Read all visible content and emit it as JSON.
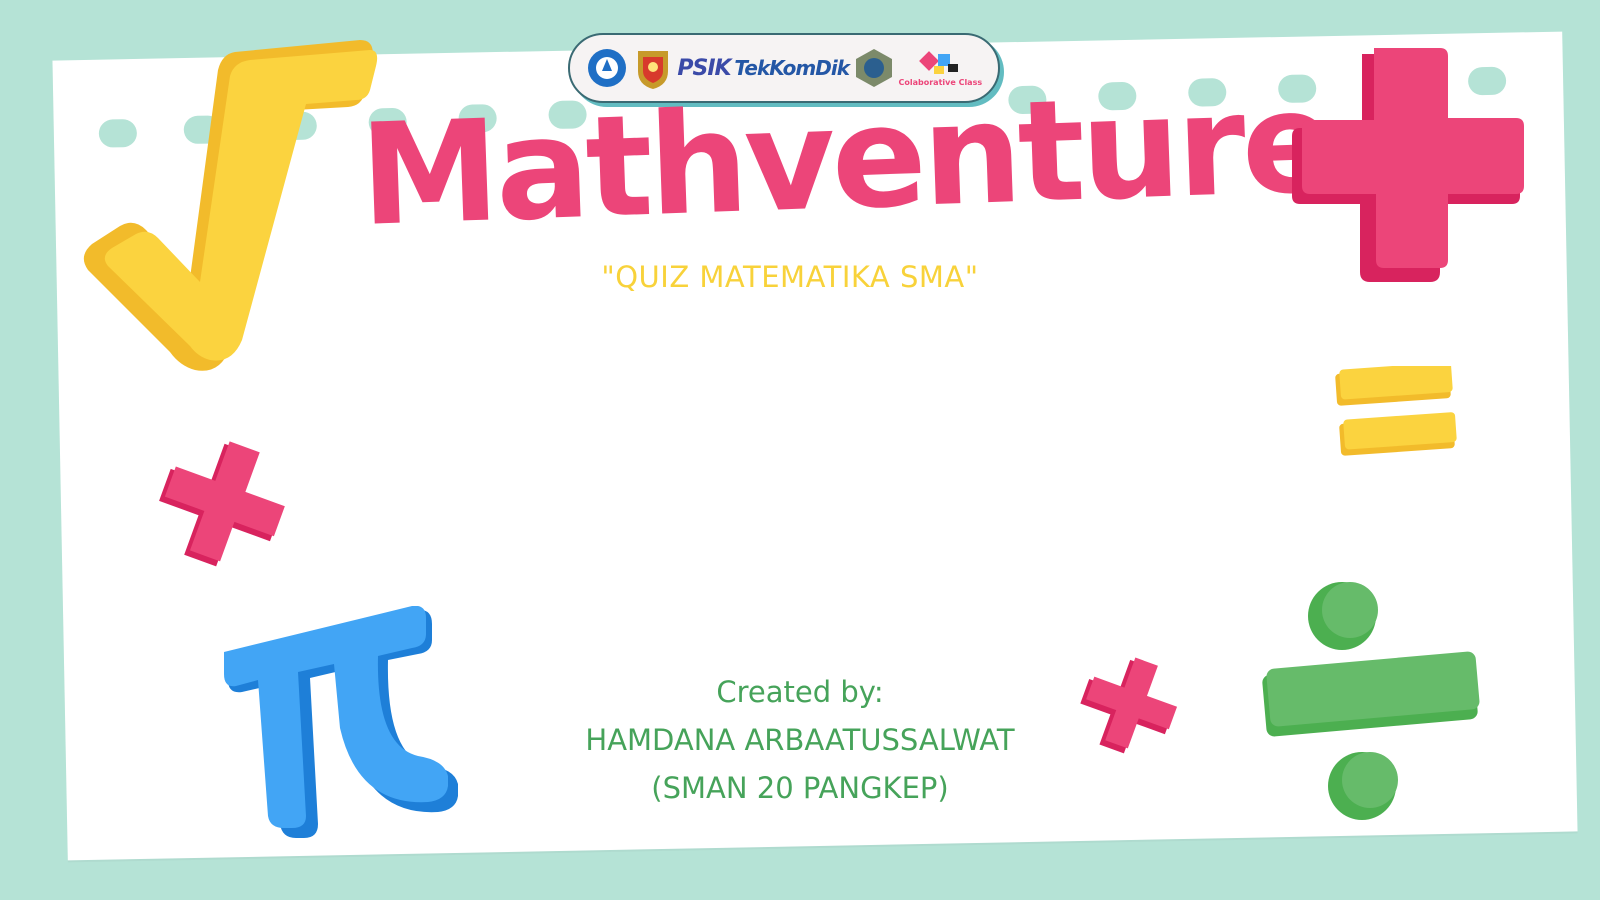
{
  "logos": {
    "items": [
      {
        "name": "ministry-emblem-icon"
      },
      {
        "name": "province-emblem-icon"
      },
      {
        "name": "psik-logo",
        "text": "PSIK"
      },
      {
        "name": "tekkomdik-logo",
        "text": "TekKomDik"
      },
      {
        "name": "institution-seal-icon"
      },
      {
        "name": "colaborative-class-logo",
        "text": "Colaborative Class"
      }
    ]
  },
  "title": "Mathventure",
  "subtitle": "\"QUIZ MATEMATIKA SMA\"",
  "credits": {
    "line1": "Created by:",
    "line2": "HAMDANA ARBAATUSSALWAT",
    "line3": "(SMAN 20 PANGKEP)"
  },
  "colors": {
    "background": "#b5e3d6",
    "title": "#ec4579",
    "subtitle": "#f8d23a",
    "credits": "#46a35a",
    "pink": "#ec4579",
    "yellow": "#fbd33f",
    "blue": "#42a5f5",
    "green": "#66bb6a"
  },
  "decorations": [
    "square-root-icon",
    "plus-icon",
    "equals-icon",
    "pi-icon",
    "divide-icon"
  ]
}
